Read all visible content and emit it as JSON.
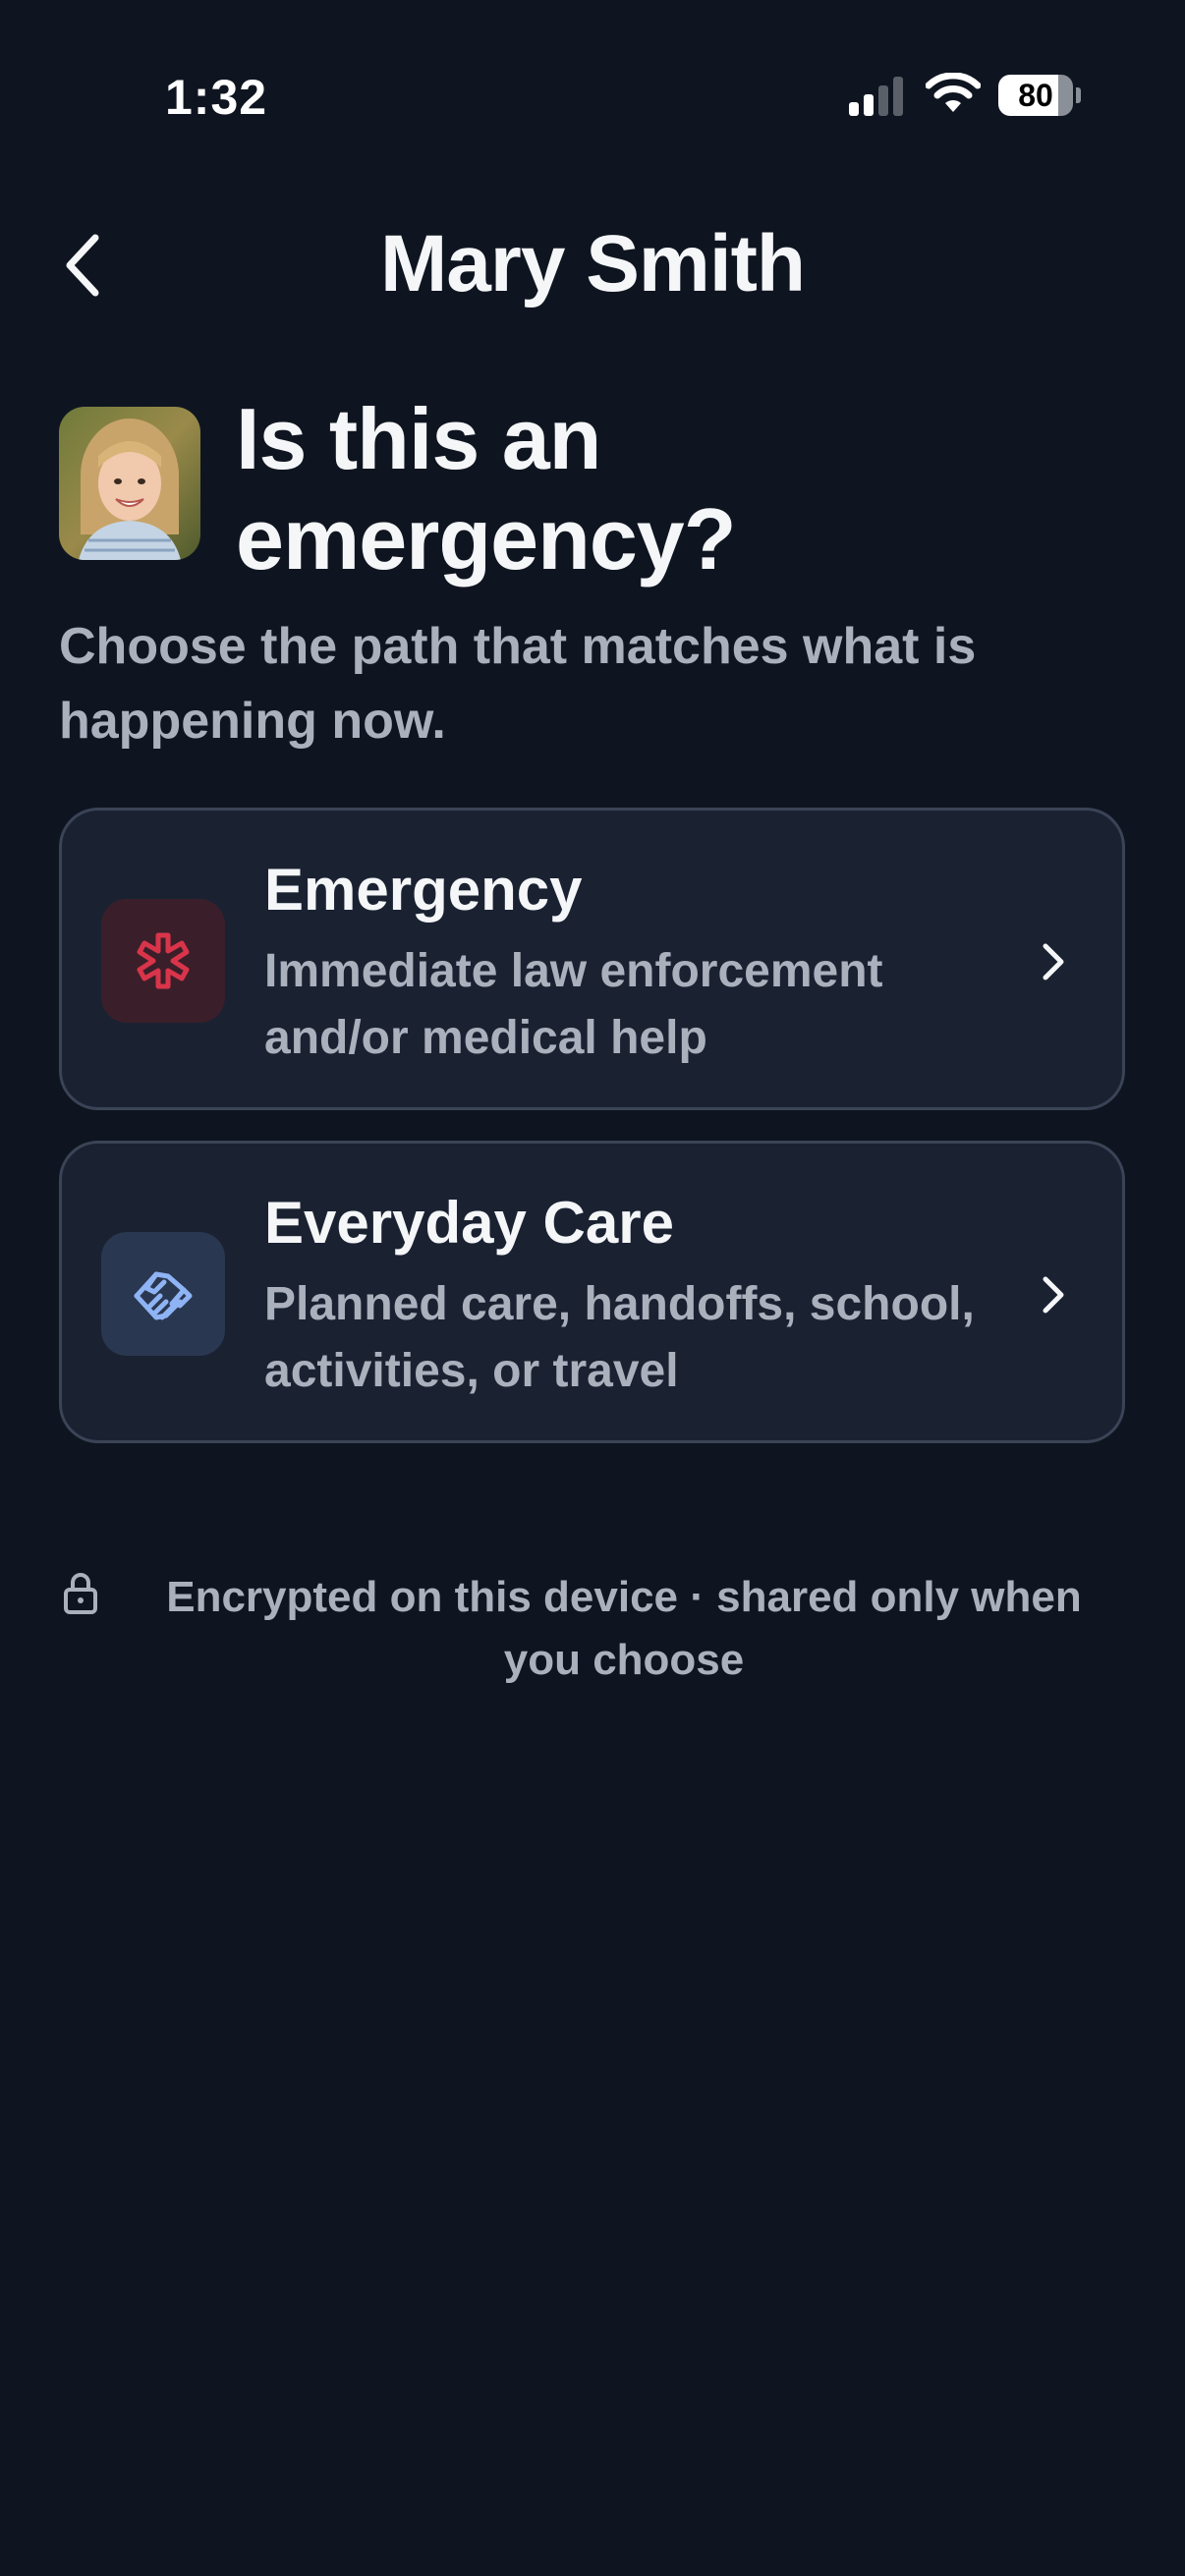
{
  "status_bar": {
    "time": "1:32",
    "battery_level": "80",
    "battery_fraction": 0.8,
    "signal_bars_active": 2,
    "signal_bars_total": 4
  },
  "nav": {
    "back_icon": "chevron-left-icon",
    "title": "Mary Smith"
  },
  "header": {
    "heading": "Is this an emergency?",
    "subtitle": "Choose the path that matches what is happening now."
  },
  "options": [
    {
      "title": "Emergency",
      "description": "Immediate law enforcement and/or medical help",
      "icon": "medical-star-icon",
      "icon_color": "#d9344a",
      "icon_bg": "#3a1f2a"
    },
    {
      "title": "Everyday Care",
      "description": "Planned care, handoffs, school, activities, or travel",
      "icon": "handshake-icon",
      "icon_color": "#8fb4f5",
      "icon_bg": "#2a3750"
    }
  ],
  "footer": {
    "icon": "lock-icon",
    "text": "Encrypted on this device · shared only when you choose"
  },
  "colors": {
    "background": "#0f1520",
    "card_background": "#1a2232",
    "card_border": "#3a4456",
    "text_primary": "#f5f6f8",
    "text_secondary": "#aab1bd"
  }
}
